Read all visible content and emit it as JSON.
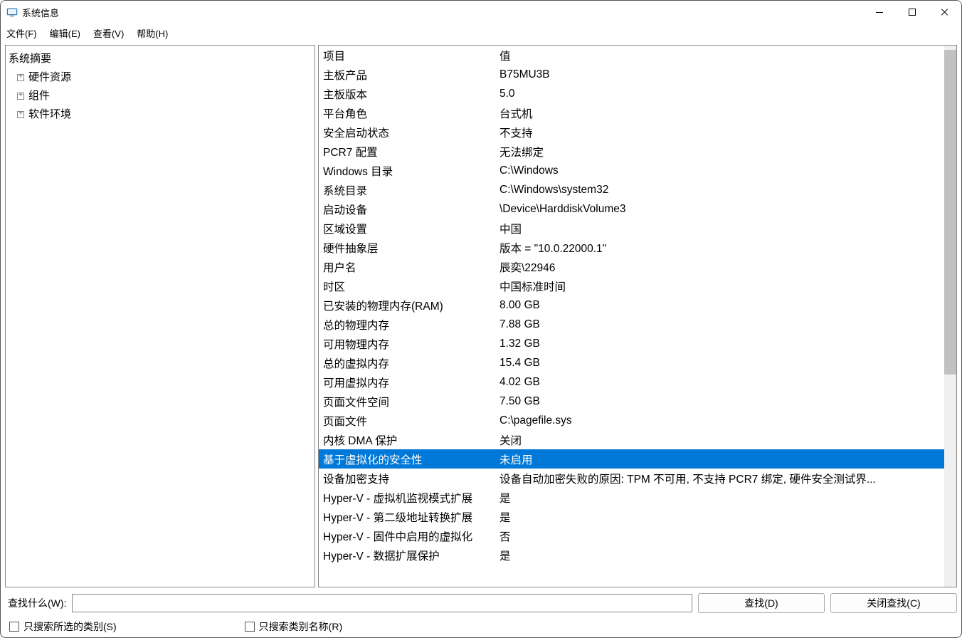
{
  "window": {
    "title": "系统信息"
  },
  "menu": {
    "file": "文件(F)",
    "edit": "编辑(E)",
    "view": "查看(V)",
    "help": "帮助(H)"
  },
  "tree": {
    "root": "系统摘要",
    "children": [
      "硬件资源",
      "组件",
      "软件环境"
    ]
  },
  "detail": {
    "header": {
      "key": "项目",
      "val": "值"
    },
    "rows": [
      {
        "key": "主板产品",
        "val": "B75MU3B"
      },
      {
        "key": "主板版本",
        "val": "5.0"
      },
      {
        "key": "平台角色",
        "val": "台式机"
      },
      {
        "key": "安全启动状态",
        "val": "不支持"
      },
      {
        "key": "PCR7 配置",
        "val": "无法绑定"
      },
      {
        "key": "Windows 目录",
        "val": "C:\\Windows"
      },
      {
        "key": "系统目录",
        "val": "C:\\Windows\\system32"
      },
      {
        "key": "启动设备",
        "val": "\\Device\\HarddiskVolume3"
      },
      {
        "key": "区域设置",
        "val": "中国"
      },
      {
        "key": "硬件抽象层",
        "val": "版本 = \"10.0.22000.1\""
      },
      {
        "key": "用户名",
        "val": "辰奕\\22946"
      },
      {
        "key": "时区",
        "val": "中国标准时间"
      },
      {
        "key": "已安装的物理内存(RAM)",
        "val": "8.00 GB"
      },
      {
        "key": "总的物理内存",
        "val": "7.88 GB"
      },
      {
        "key": "可用物理内存",
        "val": "1.32 GB"
      },
      {
        "key": "总的虚拟内存",
        "val": "15.4 GB"
      },
      {
        "key": "可用虚拟内存",
        "val": "4.02 GB"
      },
      {
        "key": "页面文件空间",
        "val": "7.50 GB"
      },
      {
        "key": "页面文件",
        "val": "C:\\pagefile.sys"
      },
      {
        "key": "内核 DMA 保护",
        "val": "关闭"
      },
      {
        "key": "基于虚拟化的安全性",
        "val": "未启用",
        "selected": true
      },
      {
        "key": "设备加密支持",
        "val": "设备自动加密失败的原因: TPM 不可用, 不支持 PCR7 绑定, 硬件安全测试界..."
      },
      {
        "key": "Hyper-V - 虚拟机监视模式扩展",
        "val": "是"
      },
      {
        "key": "Hyper-V - 第二级地址转换扩展",
        "val": "是"
      },
      {
        "key": "Hyper-V - 固件中启用的虚拟化",
        "val": "否"
      },
      {
        "key": "Hyper-V - 数据扩展保护",
        "val": "是"
      }
    ]
  },
  "search": {
    "label": "查找什么(W):",
    "find_btn": "查找(D)",
    "close_btn": "关闭查找(C)",
    "opt1": "只搜索所选的类别(S)",
    "opt2": "只搜索类别名称(R)"
  }
}
